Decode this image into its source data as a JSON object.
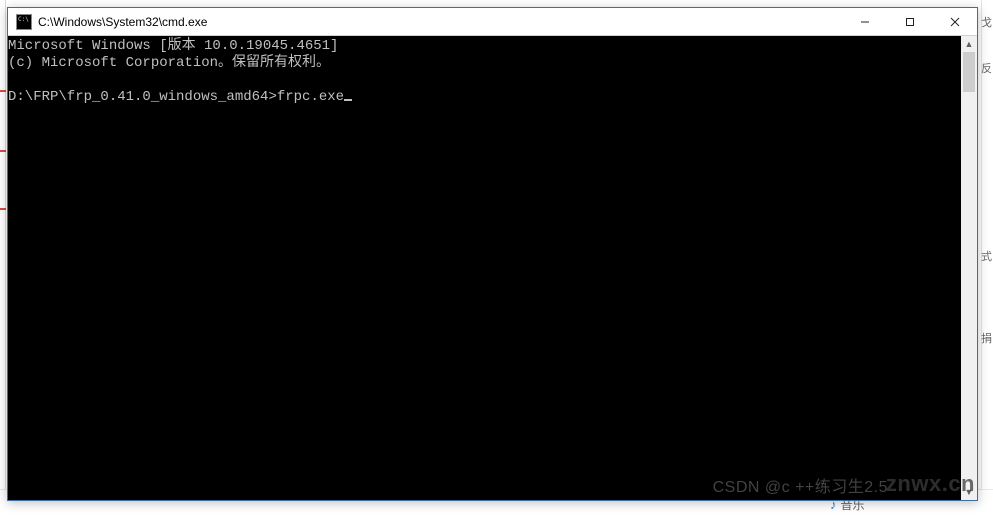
{
  "window": {
    "title": "C:\\Windows\\System32\\cmd.exe",
    "icon_name": "cmd-icon"
  },
  "console": {
    "line1": "Microsoft Windows [版本 10.0.19045.4651]",
    "line2": "(c) Microsoft Corporation。保留所有权利。",
    "blank": "",
    "prompt_path": "D:\\FRP\\frp_0.41.0_windows_amd64>",
    "typed_command": "frpc.exe"
  },
  "background": {
    "right_chars": [
      "戈",
      "反",
      "式",
      "捐"
    ],
    "music_label": "音乐"
  },
  "watermarks": {
    "csdn": "CSDN @c ++练习生2.5",
    "znwx": "znwx.cn"
  }
}
